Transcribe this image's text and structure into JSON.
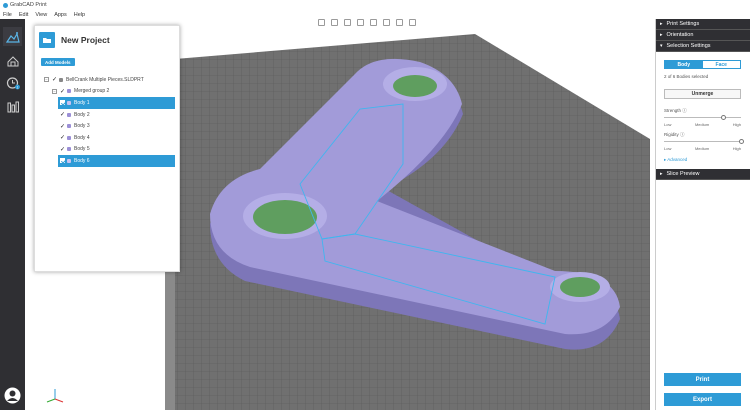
{
  "app": {
    "title": "GrabCAD Print"
  },
  "menu": {
    "file": "File",
    "edit": "Edit",
    "view": "View",
    "apps": "Apps",
    "help": "Help"
  },
  "toolbar_left": {
    "items": [
      "home-icon",
      "printer-icon",
      "schedule-icon",
      "analytics-icon"
    ],
    "active": "home-icon",
    "badge": "1"
  },
  "view_toolbar": {
    "icons": [
      "fit-view-icon",
      "top-view-icon",
      "front-view-icon",
      "side-view-icon",
      "iso-view-icon",
      "perspective-icon",
      "camera-icon",
      "measure-icon"
    ]
  },
  "project": {
    "title": "New Project",
    "add_models_label": "Add Models",
    "tree": {
      "root": "BellCrank Multiple Pieces.SLDPRT",
      "group": "Merged group 2",
      "bodies": [
        {
          "label": "Body 1",
          "selected": true,
          "color": "#9b8fd6"
        },
        {
          "label": "Body 2",
          "selected": false,
          "color": "#9b8fd6"
        },
        {
          "label": "Body 3",
          "selected": false,
          "color": "#9b8fd6"
        },
        {
          "label": "Body 4",
          "selected": false,
          "color": "#9b8fd6"
        },
        {
          "label": "Body 5",
          "selected": false,
          "color": "#9b8fd6"
        },
        {
          "label": "Body 6",
          "selected": true,
          "color": "#9b8fd6"
        }
      ]
    }
  },
  "right_panel": {
    "sections": {
      "print_settings": "Print Settings",
      "orientation": "Orientation",
      "selection_settings": "Selection Settings",
      "slice_preview": "Slice Preview"
    },
    "selection": {
      "body_tab": "Body",
      "face_tab": "Face",
      "status": "2 of 6 Bodies selected",
      "unmerge_label": "Unmerge",
      "strength": {
        "label": "Strength",
        "levels": [
          "Low",
          "Medium",
          "High"
        ],
        "value": 0.77
      },
      "rigidity": {
        "label": "Rigidity",
        "levels": [
          "Low",
          "Medium",
          "High"
        ],
        "value": 1.0
      },
      "advanced": "Advanced"
    },
    "print_label": "Print",
    "export_label": "Export"
  },
  "colors": {
    "accent": "#2e9bd6",
    "toolbar": "#2f2f33",
    "model": "#a29bd9",
    "holes": "#5f9e5f",
    "bed": "#6f6f6f"
  }
}
